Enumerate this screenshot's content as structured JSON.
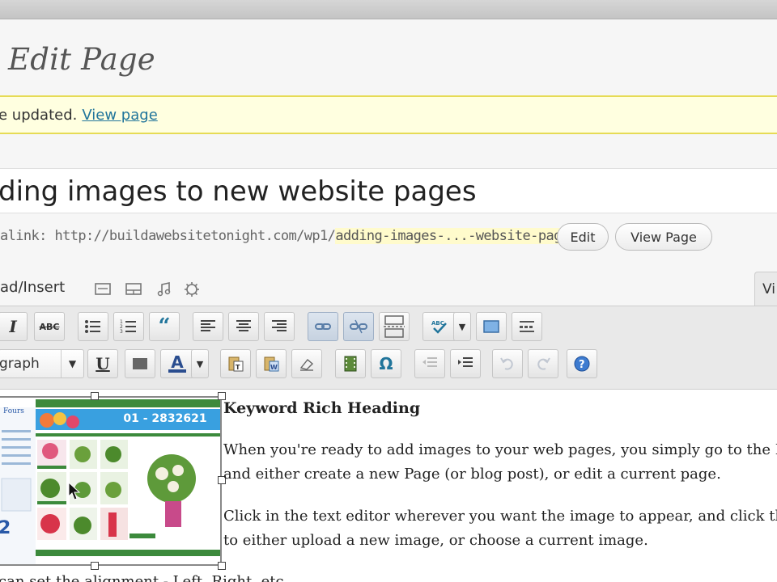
{
  "page": {
    "heading": "Edit Page",
    "notice_text": "e updated.",
    "notice_link": "View page"
  },
  "post": {
    "title": "ding images to new website pages",
    "permalink_label": "alink: http://buildawebsitetonight.com/wp1/",
    "permalink_slug": "adding-images-...-website-pages",
    "edit_button": "Edit",
    "view_button": "View Page"
  },
  "media": {
    "label": "ad/Insert",
    "icons": [
      "image-icon",
      "video-icon",
      "audio-icon",
      "media-icon"
    ]
  },
  "editor_tabs": {
    "visual": "Vi"
  },
  "toolbar": {
    "row1": [
      "bold-button",
      "italic-button",
      "strikethrough-button",
      "bullet-list-button",
      "numbered-list-button",
      "blockquote-button",
      "align-left-button",
      "align-center-button",
      "align-right-button",
      "insert-link-button",
      "unlink-button",
      "more-tag-button",
      "spellcheck-button",
      "fullscreen-button",
      "kitchen-sink-button"
    ],
    "format_select": "graph",
    "italic_glyph": "I",
    "abc_glyph": "ABC",
    "underline_glyph": "U",
    "color_glyph": "A",
    "omega_glyph": "Ω"
  },
  "content": {
    "heading": "Keyword Rich Heading",
    "p1_line1": "When you're ready to add images to your web pages, you simply go to the D",
    "p1_line2": "and either create a new Page (or blog post), or edit a current page.",
    "p2_line1": "Click in the text editor wherever you want the image to appear, and click th",
    "p2_line2": "to either upload a new image, or choose a current image.",
    "p3_partial": "can set the alignment - Left, Right, etc."
  },
  "thumbnail": {
    "phone": "01 - 2832621",
    "logo": "Fours"
  },
  "colors": {
    "notice_bg": "#ffffe0",
    "notice_border": "#e6db55",
    "link": "#21759b",
    "thumbnail_header": "#39a0e0",
    "thumbnail_green": "#3c8a3c"
  }
}
